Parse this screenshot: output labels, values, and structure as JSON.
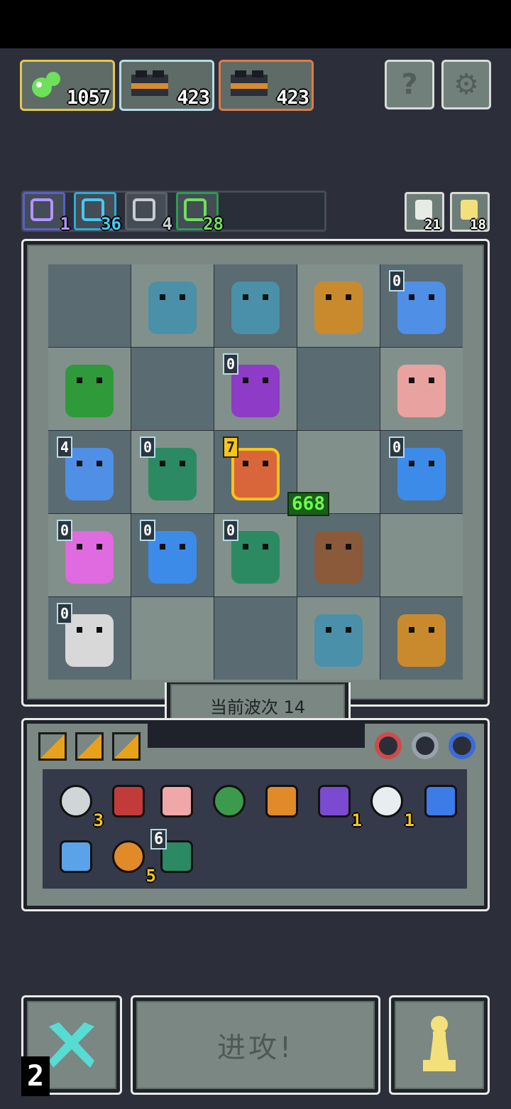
{
  "resources": [
    {
      "name": "green-blob-resource",
      "value": "1057",
      "border": "#e7c64a",
      "icon": "green-slime-icon",
      "color": "#6ee05b"
    },
    {
      "name": "chest-resource-blue",
      "value": "423",
      "border": "#b7dbe8",
      "icon": "treasure-chest-icon",
      "color": "#2c2f3a"
    },
    {
      "name": "chest-resource-orange",
      "value": "423",
      "border": "#e07a47",
      "icon": "treasure-chest-icon",
      "color": "#2c2f3a"
    }
  ],
  "top_buttons": {
    "help_glyph": "?",
    "settings_glyph": "⚙"
  },
  "stats": [
    {
      "icon": "lightning-icon",
      "value": "1",
      "border": "#5a5fc9",
      "color": "#b494ff"
    },
    {
      "icon": "swirl-icon",
      "value": "36",
      "border": "#2faad6",
      "color": "#46c9f2"
    },
    {
      "icon": "bat-icon",
      "value": "4",
      "border": "#5b6167",
      "color": "#c8cdd0"
    },
    {
      "icon": "seed-icon",
      "value": "28",
      "border": "#2e9a52",
      "color": "#6ee05b"
    }
  ],
  "mini_buttons": [
    {
      "icon": "refresh-icon",
      "value": "21"
    },
    {
      "icon": "key-icon",
      "value": "18"
    }
  ],
  "board": {
    "wave_label": "当前波次 14",
    "cells": [
      {
        "dark": true,
        "unit": null
      },
      {
        "dark": false,
        "unit": "zombie-unit",
        "color": "#4a90a8"
      },
      {
        "dark": true,
        "unit": "zombie-unit",
        "color": "#4a90a8"
      },
      {
        "dark": false,
        "unit": "chest-golem-unit",
        "color": "#c98a2e"
      },
      {
        "dark": true,
        "unit": "ice-golem-unit",
        "color": "#4f8fe6",
        "badge": "0"
      },
      {
        "dark": false,
        "unit": "treant-unit",
        "color": "#2f9a3a"
      },
      {
        "dark": true,
        "unit": null
      },
      {
        "dark": false,
        "unit": "purple-dragon-unit",
        "color": "#8e3bc8",
        "badge": "0"
      },
      {
        "dark": true,
        "unit": null
      },
      {
        "dark": false,
        "unit": "snail-unit",
        "color": "#e8a3a0"
      },
      {
        "dark": true,
        "unit": "ice-golem-unit",
        "color": "#4f8fe6",
        "badge": "4"
      },
      {
        "dark": false,
        "unit": "serpent-unit",
        "color": "#2b8a62",
        "badge": "0"
      },
      {
        "dark": true,
        "unit": "dwarf-warrior-unit",
        "color": "#d9663a",
        "badge": "7",
        "selected": true,
        "hp": "668"
      },
      {
        "dark": false,
        "unit": null
      },
      {
        "dark": true,
        "unit": "blue-flame-unit",
        "color": "#3d8be8",
        "badge": "0"
      },
      {
        "dark": false,
        "unit": "pink-demon-unit",
        "color": "#e06ae0",
        "badge": "0"
      },
      {
        "dark": true,
        "unit": "blue-flame-unit",
        "color": "#3d8be8",
        "badge": "0"
      },
      {
        "dark": false,
        "unit": "serpent-unit",
        "color": "#2b8a62",
        "badge": "0"
      },
      {
        "dark": true,
        "unit": "dryad-unit",
        "color": "#8a5a3a"
      },
      {
        "dark": false,
        "unit": null
      },
      {
        "dark": true,
        "unit": "old-sage-unit",
        "color": "#d8d8d8",
        "badge": "0"
      },
      {
        "dark": false,
        "unit": null
      },
      {
        "dark": true,
        "unit": null
      },
      {
        "dark": false,
        "unit": "zombie-unit",
        "color": "#4a90a8"
      },
      {
        "dark": true,
        "unit": "chest-golem-unit",
        "color": "#c98a2e"
      }
    ]
  },
  "inventory": {
    "ring_icons": [
      {
        "icon": "red-ring-icon",
        "color": "#d04a4a"
      },
      {
        "icon": "armor-ring-icon",
        "color": "#98a2ad"
      },
      {
        "icon": "blue-ring-icon",
        "color": "#3b6bd6"
      }
    ],
    "items": [
      {
        "icon": "scroll-icon",
        "color": "#d0d6d8",
        "count": "3"
      },
      {
        "icon": "amulet-icon",
        "color": "#c23b3b"
      },
      {
        "icon": "piggy-icon",
        "color": "#f0a7a7"
      },
      {
        "icon": "arrow-icon",
        "color": "#3c9a4d"
      },
      {
        "icon": "claw-icon",
        "color": "#e08a2a"
      },
      {
        "icon": "potion-jar-icon",
        "color": "#7a4ad0",
        "count": "1"
      },
      {
        "icon": "wing-icon",
        "color": "#e8eef0",
        "count": "1"
      },
      {
        "icon": "blue-wisp-icon",
        "color": "#3d7be8"
      },
      {
        "icon": "slime-orb-icon",
        "color": "#5aa3e8"
      },
      {
        "icon": "rune-circle-icon",
        "color": "#e08a2a",
        "count": "5"
      },
      {
        "icon": "globe-icon",
        "color": "#2b8a62",
        "level": "6"
      }
    ]
  },
  "bottom": {
    "shuffle_count": "2",
    "attack_label": "进攻!",
    "pawn_icon": "pawn-icon"
  }
}
